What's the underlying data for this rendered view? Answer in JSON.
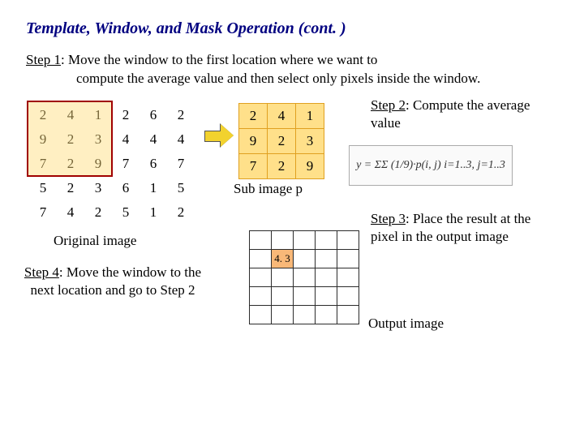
{
  "title": "Template, Window, and Mask Operation (cont. )",
  "step1": {
    "label": "Step 1",
    "text_a": ": Move the window to the first location where we want to",
    "text_b": "compute the average value and then select only pixels inside the window."
  },
  "original_grid": [
    [
      2,
      4,
      1,
      2,
      6,
      2
    ],
    [
      9,
      2,
      3,
      4,
      4,
      4
    ],
    [
      7,
      2,
      9,
      7,
      6,
      7
    ],
    [
      5,
      2,
      3,
      6,
      1,
      5
    ],
    [
      7,
      4,
      2,
      5,
      1,
      2
    ]
  ],
  "original_caption": "Original image",
  "sub_grid": [
    [
      2,
      4,
      1
    ],
    [
      9,
      2,
      3
    ],
    [
      7,
      2,
      9
    ]
  ],
  "sub_caption": "Sub image p",
  "step2": {
    "label": "Step 2",
    "text": ": Compute the average value"
  },
  "formula": "y = ΣΣ (1/9)·p(i, j)  i=1..3, j=1..3",
  "output_value": "4. 3",
  "output_caption": "Output image",
  "step3": {
    "label": "Step 3",
    "text": ": Place the result at the pixel in the output image"
  },
  "step4": {
    "label": "Step 4",
    "text": ": Move the window to the next location and go to Step 2"
  },
  "chart_data": {
    "type": "table",
    "title": "Template, Window, and Mask Operation — spatial averaging example",
    "original_image": [
      [
        2,
        4,
        1,
        2,
        6,
        2
      ],
      [
        9,
        2,
        3,
        4,
        4,
        4
      ],
      [
        7,
        2,
        9,
        7,
        6,
        7
      ],
      [
        5,
        2,
        3,
        6,
        1,
        5
      ],
      [
        7,
        4,
        2,
        5,
        1,
        2
      ]
    ],
    "window_position": {
      "row": 0,
      "col": 0,
      "size": 3
    },
    "sub_image_p": [
      [
        2,
        4,
        1
      ],
      [
        9,
        2,
        3
      ],
      [
        7,
        2,
        9
      ]
    ],
    "formula": "y = (1/9) * sum_{i=1..3} sum_{j=1..3} p(i,j)",
    "output_value_at_1_1": 4.3
  }
}
